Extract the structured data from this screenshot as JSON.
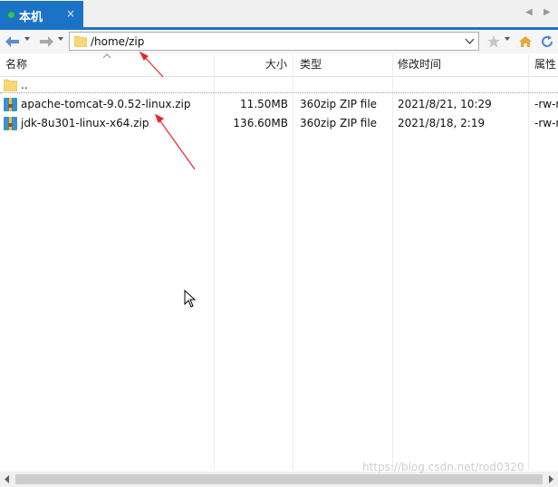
{
  "tab": {
    "label": "本机",
    "close": "×"
  },
  "address": {
    "path": "/home/zip"
  },
  "columns": {
    "name": "名称",
    "size": "大小",
    "type": "类型",
    "modified": "修改时间",
    "attrs": "属性"
  },
  "rows": [
    {
      "name": "..",
      "size": "",
      "type": "",
      "modified": "",
      "attrs": ""
    },
    {
      "name": "apache-tomcat-9.0.52-linux.zip",
      "size": "11.50MB",
      "type": "360zip ZIP file",
      "modified": "2021/8/21, 10:29",
      "attrs": "-rw-r"
    },
    {
      "name": "jdk-8u301-linux-x64.zip",
      "size": "136.60MB",
      "type": "360zip ZIP file",
      "modified": "2021/8/18, 2:19",
      "attrs": "-rw-r"
    }
  ],
  "watermark": "https://blog.csdn.net/rod0320",
  "colors": {
    "accent": "#1b73c6",
    "annotation": "#e8262a"
  }
}
